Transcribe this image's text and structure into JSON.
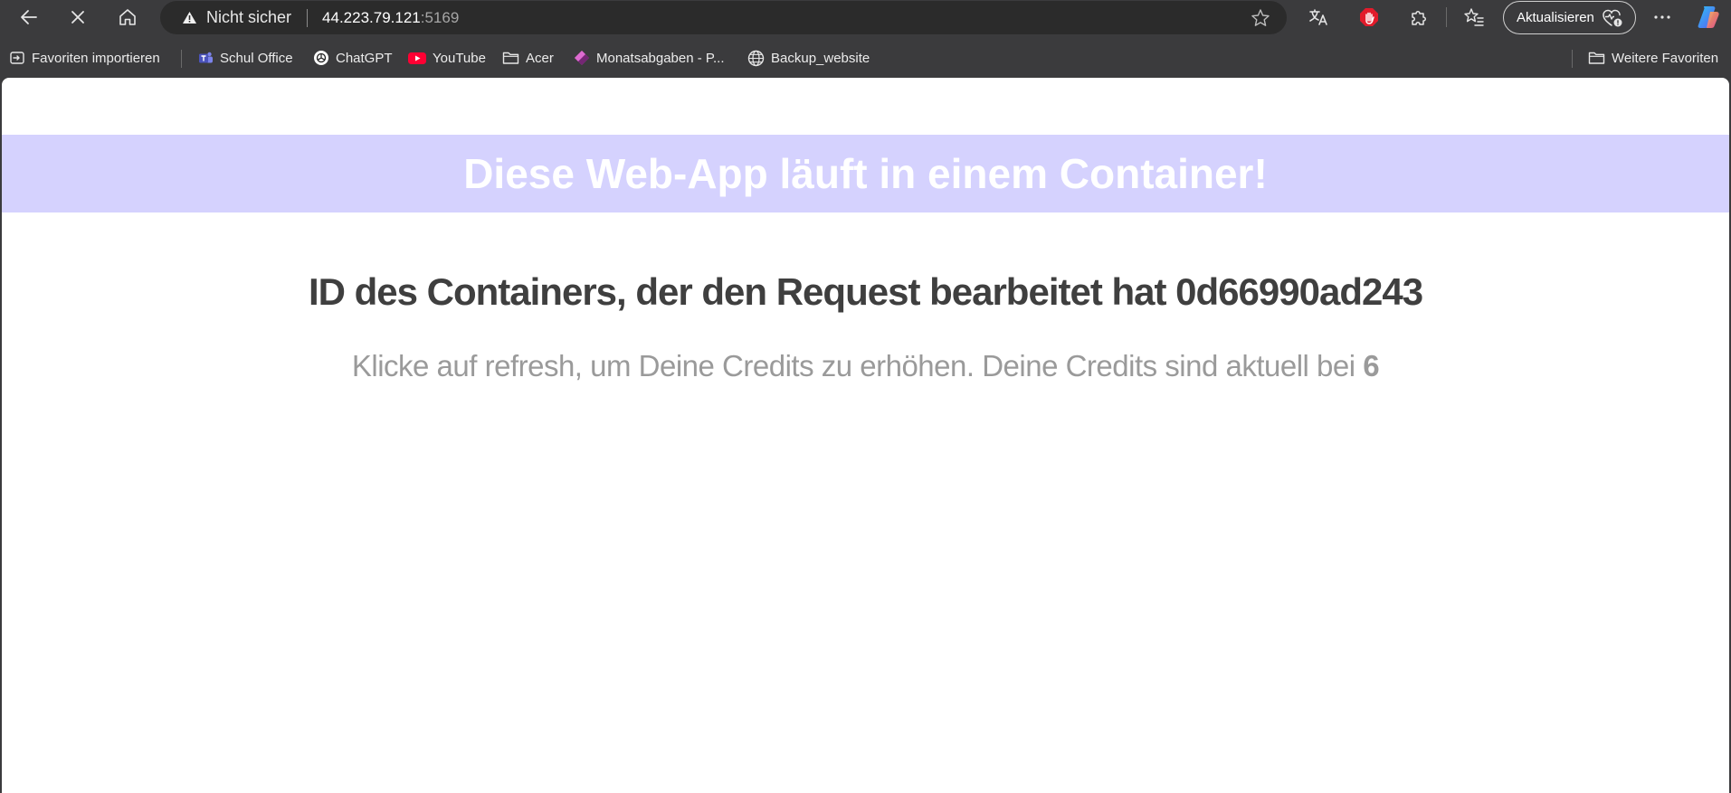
{
  "toolbar": {
    "security_text": "Nicht sicher",
    "url_host": "44.223.79.121",
    "url_port": ":5169",
    "update_label": "Aktualisieren"
  },
  "favorites": {
    "import_label": "Favoriten importieren",
    "items": [
      {
        "label": "Schul Office",
        "icon": "teams-icon"
      },
      {
        "label": "ChatGPT",
        "icon": "chatgpt-icon"
      },
      {
        "label": "YouTube",
        "icon": "youtube-icon"
      },
      {
        "label": "Acer",
        "icon": "folder-icon"
      },
      {
        "label": "Monatsabgaben - P...",
        "icon": "powerapps-icon"
      },
      {
        "label": "Backup_website",
        "icon": "globe-icon"
      }
    ],
    "more_label": "Weitere Favoriten"
  },
  "page": {
    "banner_title": "Diese Web-App läuft in einem Container!",
    "container_id_text": "ID des Containers, der den Request bearbeitet hat 0d66990ad243",
    "credits_text": "Klicke auf refresh, um Deine Credits zu erhöhen. Deine Credits sind aktuell bei ",
    "credits_value": "6"
  },
  "colors": {
    "banner_bg": "#d5d2fe",
    "heading_text": "#3f3f3f",
    "subtext": "#9a9a9a",
    "chrome_bg": "#3b3b3d"
  }
}
